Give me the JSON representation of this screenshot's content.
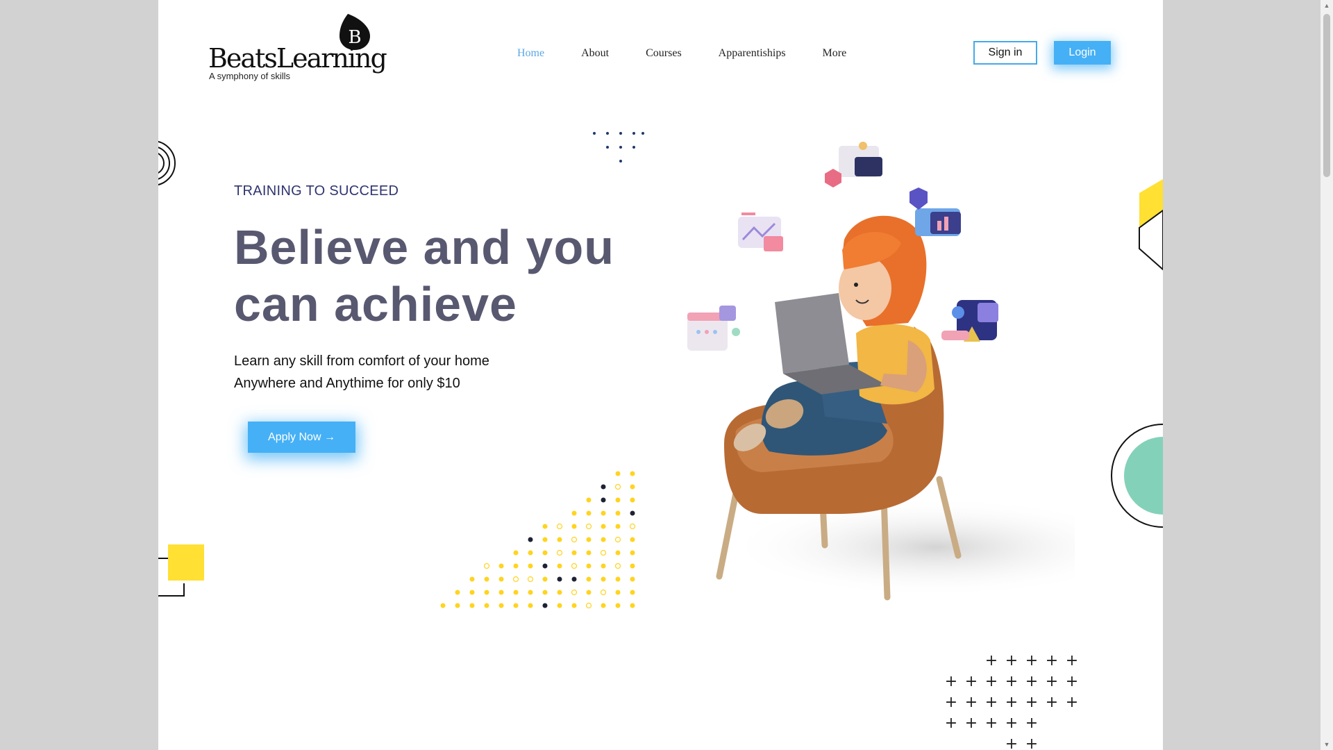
{
  "header": {
    "logo_badge": "B",
    "logo_name": "BeatsLearning",
    "logo_tagline": "A symphony of skills",
    "nav": [
      {
        "label": "Home",
        "active": true
      },
      {
        "label": "About",
        "active": false
      },
      {
        "label": "Courses",
        "active": false
      },
      {
        "label": "Apparentiships",
        "active": false
      },
      {
        "label": "More",
        "active": false
      }
    ],
    "signin_label": "Sign in",
    "login_label": "Login"
  },
  "hero": {
    "eyebrow": "TRAINING TO SUCCEED",
    "headline_line1": "Believe and you",
    "headline_line2": "can achieve",
    "sub_line1": "Learn any skill from comfort of your home",
    "sub_line2": "Anywhere and Anythime for only $10",
    "cta_label": "Apply Now →"
  },
  "colors": {
    "accent_blue": "#45b0f5",
    "nav_active": "#5aa7e6",
    "headline": "#585870",
    "eyebrow": "#2f3470",
    "deco_yellow": "#ffe033",
    "deco_green": "#84d1b9"
  }
}
